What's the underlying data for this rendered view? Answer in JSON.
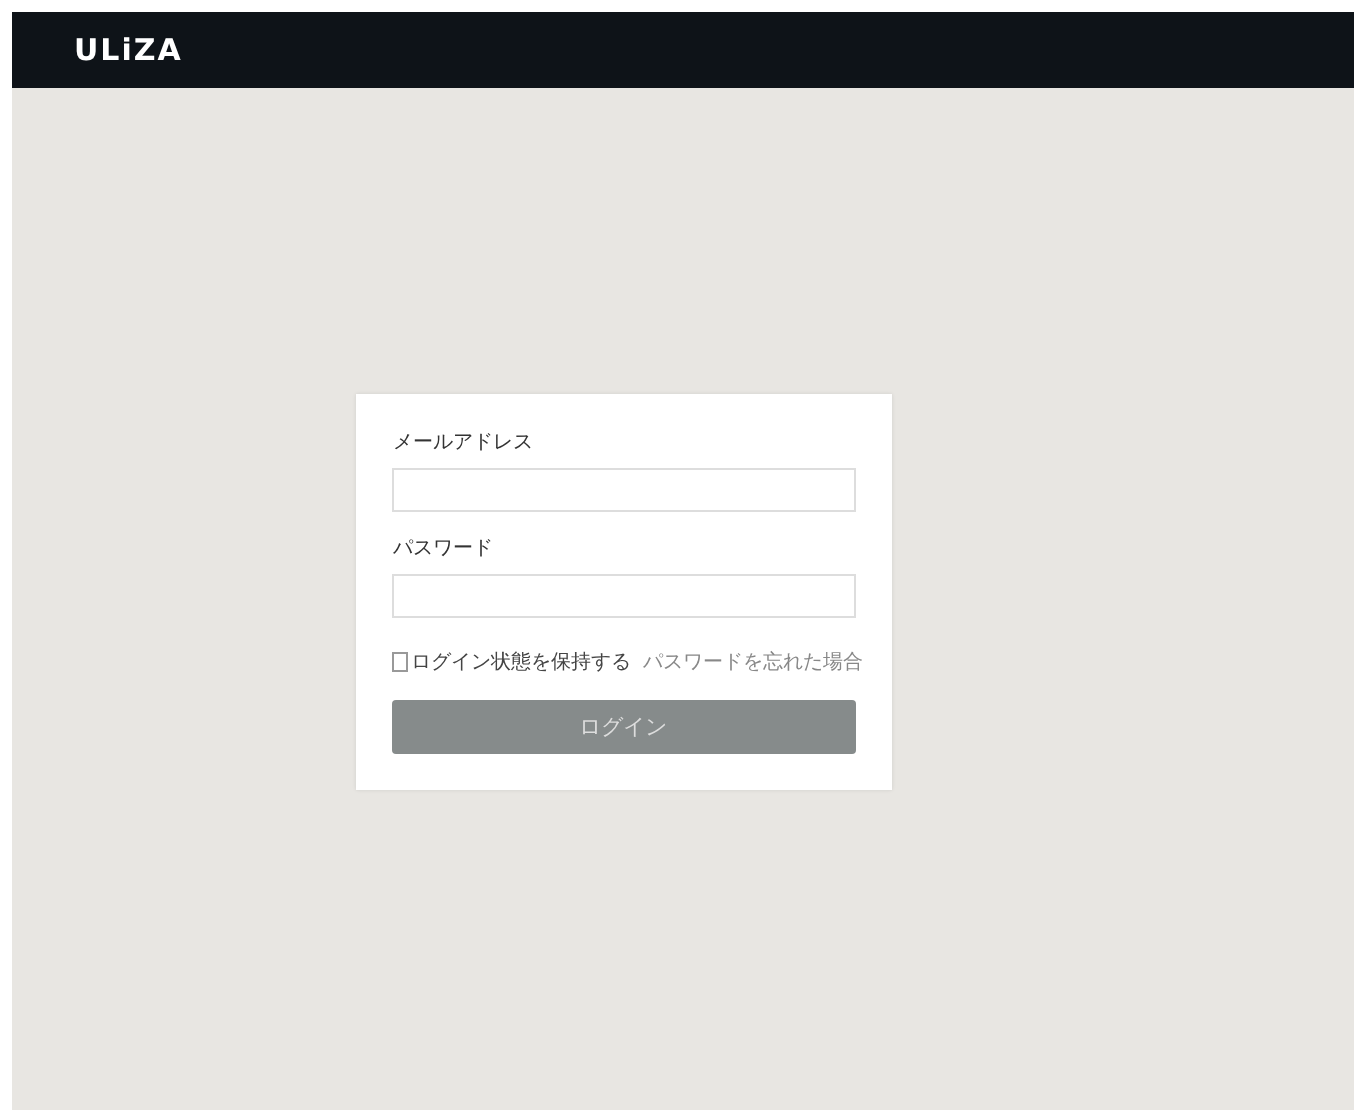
{
  "header": {
    "logo": "ULiZA"
  },
  "login_form": {
    "email_label": "メールアドレス",
    "password_label": "パスワード",
    "remember": {
      "label": "ログイン状態を保持する",
      "checked": false
    },
    "forgot_link": "パスワードを忘れた場合",
    "submit": {
      "label": "ログイン",
      "disabled": true
    }
  }
}
